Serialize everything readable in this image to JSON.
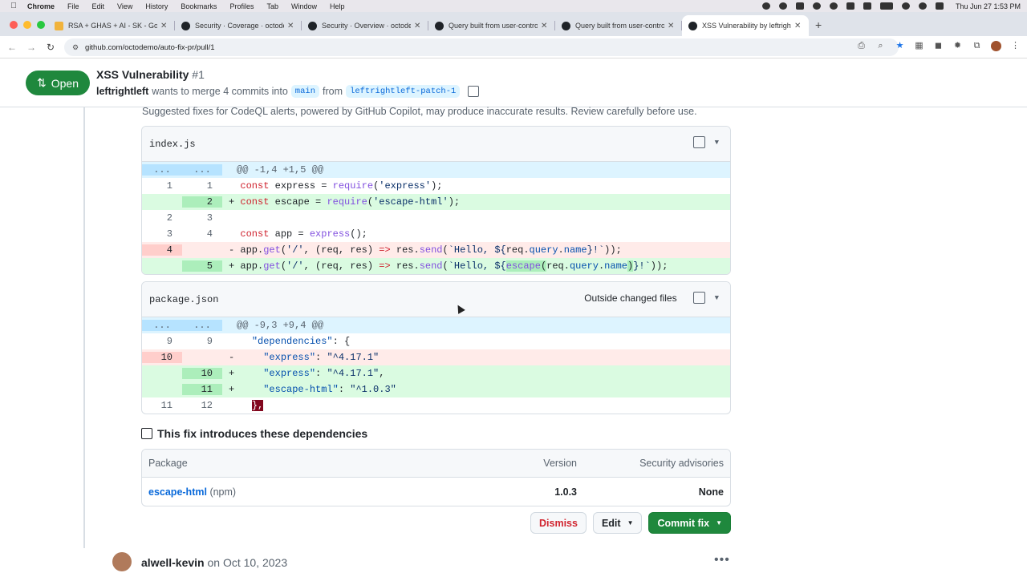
{
  "menubar": {
    "app": "Chrome",
    "items": [
      "File",
      "Edit",
      "View",
      "History",
      "Bookmarks",
      "Profiles",
      "Tab",
      "Window",
      "Help"
    ],
    "clock": "Thu Jun 27  1:53 PM"
  },
  "tabs": [
    {
      "label": "RSA + GHAS + AI - SK - Goog",
      "icon": "mail-icon"
    },
    {
      "label": "Security · Coverage · octodem",
      "icon": "github-icon"
    },
    {
      "label": "Security · Overview · octodem",
      "icon": "github-icon"
    },
    {
      "label": "Query built from user-contro",
      "icon": "github-icon"
    },
    {
      "label": "Query built from user-contro",
      "icon": "github-icon"
    },
    {
      "label": "XSS Vulnerability by leftright",
      "icon": "github-icon",
      "active": true
    }
  ],
  "address": {
    "url": "github.com/octodemo/auto-fix-pr/pull/1"
  },
  "pr": {
    "state": "Open",
    "title": "XSS Vulnerability",
    "number": "#1",
    "author": "leftrightleft",
    "merge_text": "wants to merge 4 commits into",
    "base": "main",
    "from_text": "from",
    "head": "leftrightleft-patch-1"
  },
  "note": "Suggested fixes for CodeQL alerts, powered by GitHub Copilot, may produce inaccurate results. Review carefully before use.",
  "files": [
    {
      "name": "index.js",
      "hunk": "@@ -1,4 +1,5 @@",
      "hunk_dots": "...",
      "lines": [
        {
          "type": "ctx",
          "old": "1",
          "new": "1",
          "code": "  const express = require('express');"
        },
        {
          "type": "add",
          "old": "",
          "new": "2",
          "code": "+ const escape = require('escape-html');"
        },
        {
          "type": "ctx",
          "old": "2",
          "new": "3",
          "code": ""
        },
        {
          "type": "ctx",
          "old": "3",
          "new": "4",
          "code": "  const app = express();"
        },
        {
          "type": "del",
          "old": "4",
          "new": "",
          "code": "- app.get('/', (req, res) => res.send(`Hello, ${req.query.name}!`));"
        },
        {
          "type": "add",
          "old": "",
          "new": "5",
          "code": "+ app.get('/', (req, res) => res.send(`Hello, ${escape(req.query.name)}!`));"
        }
      ]
    },
    {
      "name": "package.json",
      "badge": "Outside changed files",
      "hunk": "@@ -9,3 +9,4 @@",
      "hunk_dots": "...",
      "lines": [
        {
          "type": "ctx",
          "old": "9",
          "new": "9",
          "code": "    \"dependencies\": {"
        },
        {
          "type": "del",
          "old": "10",
          "new": "",
          "code": "-     \"express\": \"^4.17.1\""
        },
        {
          "type": "add",
          "old": "",
          "new": "10",
          "code": "+     \"express\": \"^4.17.1\","
        },
        {
          "type": "add",
          "old": "",
          "new": "11",
          "code": "+     \"escape-html\": \"^1.0.3\""
        },
        {
          "type": "ctx",
          "old": "11",
          "new": "12",
          "code": "    },"
        }
      ]
    }
  ],
  "deps": {
    "title": "This fix introduces these dependencies",
    "headers": {
      "package": "Package",
      "version": "Version",
      "advisories": "Security advisories"
    },
    "rows": [
      {
        "package": "escape-html",
        "ecosystem": "(npm)",
        "version": "1.0.3",
        "advisories": "None"
      }
    ]
  },
  "actions": {
    "dismiss": "Dismiss",
    "edit": "Edit",
    "commit": "Commit fix"
  },
  "comment": {
    "author": "alwell-kevin",
    "on": "on",
    "date": "Oct 10, 2023"
  }
}
